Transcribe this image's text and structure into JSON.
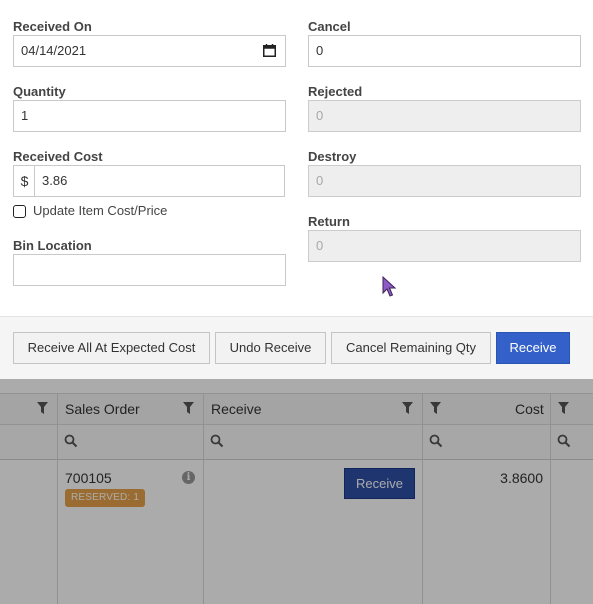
{
  "form": {
    "received_on": {
      "label": "Received On",
      "value": "04/14/2021"
    },
    "quantity": {
      "label": "Quantity",
      "value": "1"
    },
    "received_cost": {
      "label": "Received Cost",
      "currency_symbol": "$",
      "value": "3.86"
    },
    "update_item_cost": {
      "label": "Update Item Cost/Price",
      "checked": false
    },
    "bin_location": {
      "label": "Bin Location",
      "value": ""
    },
    "cancel": {
      "label": "Cancel",
      "value": "0"
    },
    "rejected": {
      "label": "Rejected",
      "value": "0"
    },
    "destroy": {
      "label": "Destroy",
      "value": "0"
    },
    "return": {
      "label": "Return",
      "value": "0"
    }
  },
  "actions": {
    "receive_all": "Receive All At Expected Cost",
    "undo_receive": "Undo Receive",
    "cancel_remaining": "Cancel Remaining Qty",
    "receive": "Receive"
  },
  "grid": {
    "columns": [
      "Sales Order",
      "Receive",
      "Cost"
    ],
    "rows": [
      {
        "sales_order": "700105",
        "badge": "RESERVED: 1",
        "receive_button": "Receive",
        "cost": "3.8600"
      }
    ]
  },
  "colors": {
    "primary": "#3461c9",
    "badge": "#e8a24a",
    "disabled_bg": "#eeeeee"
  }
}
